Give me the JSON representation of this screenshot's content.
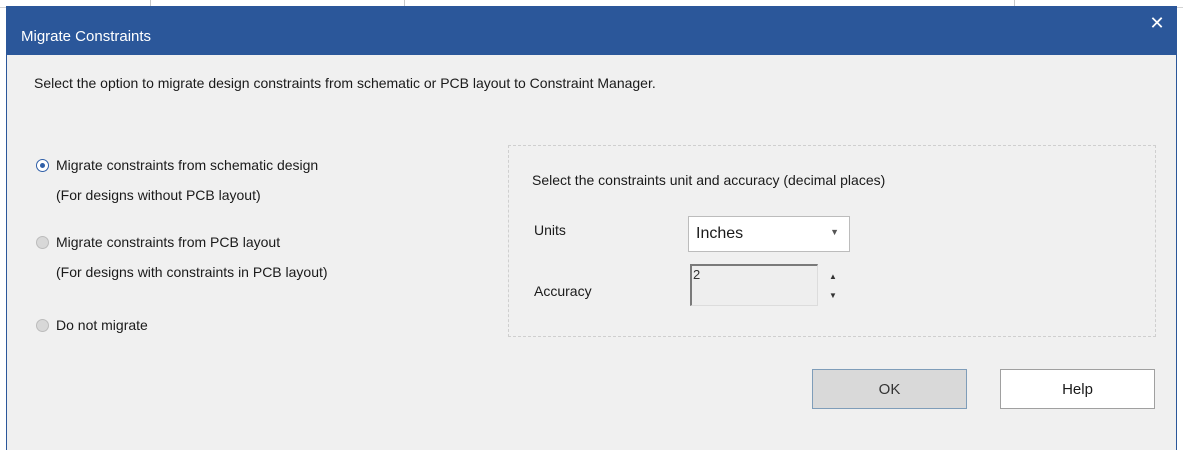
{
  "dialog": {
    "title": "Migrate Constraints",
    "close_symbol": "✕",
    "instruction": "Select the option to migrate design constraints from schematic or PCB layout to Constraint Manager."
  },
  "options": [
    {
      "label": "Migrate constraints from schematic design",
      "note": "(For designs without PCB layout)",
      "checked": true
    },
    {
      "label": "Migrate constraints from PCB layout",
      "note": "(For designs with constraints in PCB layout)",
      "checked": false
    },
    {
      "label": "Do not migrate",
      "checked": false
    }
  ],
  "units_group": {
    "heading": "Select the constraints unit and accuracy (decimal places)",
    "units_label": "Units",
    "units_value": "Inches",
    "accuracy_label": "Accuracy",
    "accuracy_value": "2"
  },
  "buttons": {
    "ok": "OK",
    "help": "Help"
  },
  "colors": {
    "titlebar": "#2b579a",
    "dialog_bg": "#f0f0f0",
    "radio_selected": "#2f5fa8"
  },
  "icons": {
    "close": "close-icon",
    "dropdown": "chevron-down-icon",
    "spin_up": "spin-up-icon",
    "spin_down": "spin-down-icon"
  }
}
